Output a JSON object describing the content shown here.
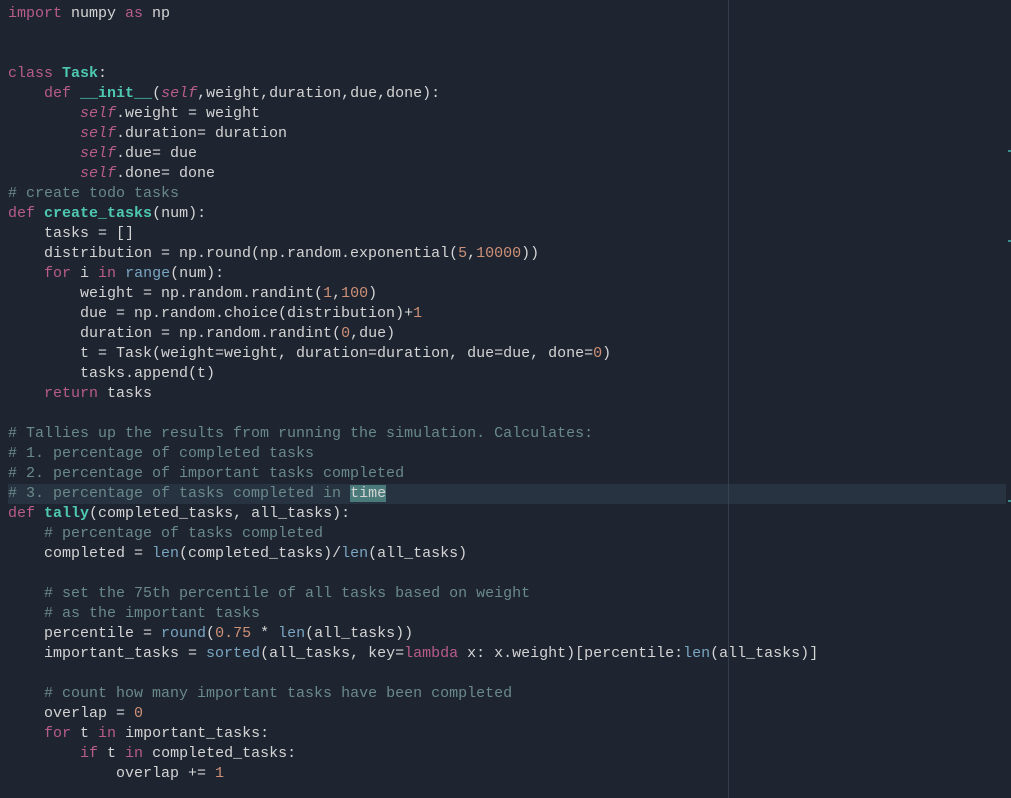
{
  "ruler_col": 80,
  "highlighted_line_index": 25,
  "selection_word": "time",
  "lines": [
    {
      "t": "code",
      "seg": [
        [
          "kw-import",
          "import"
        ],
        [
          "ident",
          " numpy "
        ],
        [
          "kw-as",
          "as"
        ],
        [
          "ident",
          " np"
        ]
      ]
    },
    {
      "t": "blank"
    },
    {
      "t": "blank"
    },
    {
      "t": "code",
      "seg": [
        [
          "kw-class",
          "class"
        ],
        [
          "ident",
          " "
        ],
        [
          "class-name",
          "Task"
        ],
        [
          "punct",
          ":"
        ]
      ]
    },
    {
      "t": "code",
      "seg": [
        [
          "ident",
          "    "
        ],
        [
          "kw-def",
          "def"
        ],
        [
          "ident",
          " "
        ],
        [
          "fn-name",
          "__init__"
        ],
        [
          "punct",
          "("
        ],
        [
          "self",
          "self"
        ],
        [
          "punct",
          ",weight,duration,due,done):"
        ]
      ]
    },
    {
      "t": "code",
      "seg": [
        [
          "ident",
          "        "
        ],
        [
          "self",
          "self"
        ],
        [
          "punct",
          ".weight = weight"
        ]
      ]
    },
    {
      "t": "code",
      "seg": [
        [
          "ident",
          "        "
        ],
        [
          "self",
          "self"
        ],
        [
          "punct",
          ".duration= duration"
        ]
      ]
    },
    {
      "t": "code",
      "seg": [
        [
          "ident",
          "        "
        ],
        [
          "self",
          "self"
        ],
        [
          "punct",
          ".due= due"
        ]
      ]
    },
    {
      "t": "code",
      "seg": [
        [
          "ident",
          "        "
        ],
        [
          "self",
          "self"
        ],
        [
          "punct",
          ".done= done"
        ]
      ]
    },
    {
      "t": "code",
      "seg": [
        [
          "comment",
          "# create todo tasks"
        ]
      ]
    },
    {
      "t": "code",
      "seg": [
        [
          "kw-def",
          "def"
        ],
        [
          "ident",
          " "
        ],
        [
          "fn-name",
          "create_tasks"
        ],
        [
          "punct",
          "(num):"
        ]
      ]
    },
    {
      "t": "code",
      "seg": [
        [
          "ident",
          "    tasks = []"
        ]
      ]
    },
    {
      "t": "code",
      "seg": [
        [
          "ident",
          "    distribution = np.round(np.random.exponential("
        ],
        [
          "num",
          "5"
        ],
        [
          "punct",
          ","
        ],
        [
          "num",
          "10000"
        ],
        [
          "punct",
          "))"
        ]
      ]
    },
    {
      "t": "code",
      "seg": [
        [
          "ident",
          "    "
        ],
        [
          "kw-for",
          "for"
        ],
        [
          "ident",
          " i "
        ],
        [
          "kw-in",
          "in"
        ],
        [
          "ident",
          " "
        ],
        [
          "builtin",
          "range"
        ],
        [
          "punct",
          "(num):"
        ]
      ]
    },
    {
      "t": "code",
      "seg": [
        [
          "ident",
          "        weight = np.random.randint("
        ],
        [
          "num",
          "1"
        ],
        [
          "punct",
          ","
        ],
        [
          "num",
          "100"
        ],
        [
          "punct",
          ")"
        ]
      ]
    },
    {
      "t": "code",
      "seg": [
        [
          "ident",
          "        due = np.random.choice(distribution)+"
        ],
        [
          "num",
          "1"
        ]
      ]
    },
    {
      "t": "code",
      "seg": [
        [
          "ident",
          "        duration = np.random.randint("
        ],
        [
          "num",
          "0"
        ],
        [
          "punct",
          ",due)"
        ]
      ]
    },
    {
      "t": "code",
      "seg": [
        [
          "ident",
          "        t = Task(weight=weight, duration=duration, due=due, done="
        ],
        [
          "num",
          "0"
        ],
        [
          "punct",
          ")"
        ]
      ]
    },
    {
      "t": "code",
      "seg": [
        [
          "ident",
          "        tasks.append(t)"
        ]
      ]
    },
    {
      "t": "code",
      "seg": [
        [
          "ident",
          "    "
        ],
        [
          "kw-return",
          "return"
        ],
        [
          "ident",
          " tasks"
        ]
      ]
    },
    {
      "t": "blank"
    },
    {
      "t": "code",
      "seg": [
        [
          "comment",
          "# Tallies up the results from running the simulation. Calculates:"
        ]
      ]
    },
    {
      "t": "code",
      "seg": [
        [
          "comment",
          "# 1. percentage of completed tasks"
        ]
      ]
    },
    {
      "t": "code",
      "seg": [
        [
          "comment",
          "# 2. percentage of important tasks completed"
        ]
      ]
    },
    {
      "t": "code",
      "seg": [
        [
          "comment",
          "# 3. percentage of tasks completed in "
        ],
        [
          "sel",
          "time"
        ]
      ],
      "hl": true
    },
    {
      "t": "code",
      "seg": [
        [
          "kw-def",
          "def"
        ],
        [
          "ident",
          " "
        ],
        [
          "fn-name",
          "tally"
        ],
        [
          "punct",
          "(completed_tasks, all_tasks):"
        ]
      ]
    },
    {
      "t": "code",
      "seg": [
        [
          "ident",
          "    "
        ],
        [
          "comment",
          "# percentage of tasks completed"
        ]
      ]
    },
    {
      "t": "code",
      "seg": [
        [
          "ident",
          "    completed = "
        ],
        [
          "builtin",
          "len"
        ],
        [
          "punct",
          "(completed_tasks)/"
        ],
        [
          "builtin",
          "len"
        ],
        [
          "punct",
          "(all_tasks)"
        ]
      ]
    },
    {
      "t": "blank"
    },
    {
      "t": "code",
      "seg": [
        [
          "ident",
          "    "
        ],
        [
          "comment",
          "# set the 75th percentile of all tasks based on weight"
        ]
      ]
    },
    {
      "t": "code",
      "seg": [
        [
          "ident",
          "    "
        ],
        [
          "comment",
          "# as the important tasks"
        ]
      ]
    },
    {
      "t": "code",
      "seg": [
        [
          "ident",
          "    percentile = "
        ],
        [
          "builtin",
          "round"
        ],
        [
          "punct",
          "("
        ],
        [
          "num",
          "0.75"
        ],
        [
          "punct",
          " * "
        ],
        [
          "builtin",
          "len"
        ],
        [
          "punct",
          "(all_tasks))"
        ]
      ]
    },
    {
      "t": "code",
      "seg": [
        [
          "ident",
          "    important_tasks = "
        ],
        [
          "builtin",
          "sorted"
        ],
        [
          "punct",
          "(all_tasks, key="
        ],
        [
          "kw-lambda",
          "lambda"
        ],
        [
          "punct",
          " x: x.weight)[percentile:"
        ],
        [
          "builtin",
          "len"
        ],
        [
          "punct",
          "(all_tasks)]"
        ]
      ]
    },
    {
      "t": "blank"
    },
    {
      "t": "code",
      "seg": [
        [
          "ident",
          "    "
        ],
        [
          "comment",
          "# count how many important tasks have been completed"
        ]
      ]
    },
    {
      "t": "code",
      "seg": [
        [
          "ident",
          "    overlap = "
        ],
        [
          "num",
          "0"
        ]
      ]
    },
    {
      "t": "code",
      "seg": [
        [
          "ident",
          "    "
        ],
        [
          "kw-for",
          "for"
        ],
        [
          "ident",
          " t "
        ],
        [
          "kw-in",
          "in"
        ],
        [
          "ident",
          " important_tasks:"
        ]
      ]
    },
    {
      "t": "code",
      "seg": [
        [
          "ident",
          "        "
        ],
        [
          "kw-if",
          "if"
        ],
        [
          "ident",
          " t "
        ],
        [
          "kw-in",
          "in"
        ],
        [
          "ident",
          " completed_tasks:"
        ]
      ]
    },
    {
      "t": "code",
      "seg": [
        [
          "ident",
          "            overlap += "
        ],
        [
          "num",
          "1"
        ]
      ]
    }
  ],
  "minimap_marks": [
    150,
    240,
    500
  ]
}
